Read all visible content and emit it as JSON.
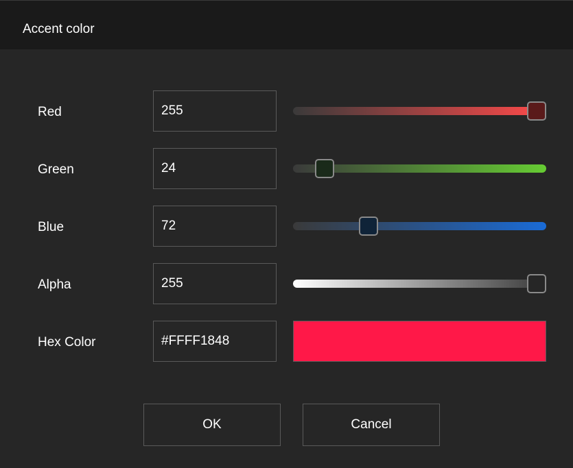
{
  "dialog": {
    "title": "Accent color"
  },
  "rows": {
    "red": {
      "label": "Red",
      "value": "255",
      "level": 1.0,
      "track_from": "#3a3a3a",
      "track_to": "#ff4a4a",
      "thumb_fill": "#5a1a1a"
    },
    "green": {
      "label": "Green",
      "value": "24",
      "level": 0.094,
      "track_from": "#3a3a3a",
      "track_to": "#66cc33",
      "thumb_fill": "#1a2a1a"
    },
    "blue": {
      "label": "Blue",
      "value": "72",
      "level": 0.282,
      "track_from": "#3a3a3a",
      "track_to": "#1a6bd6",
      "thumb_fill": "#0f2338"
    },
    "alpha": {
      "label": "Alpha",
      "value": "255",
      "level": 1.0,
      "track_from": "#ffffff",
      "track_to": "#3a3a3a",
      "thumb_fill": "#262626"
    }
  },
  "hex": {
    "label": "Hex Color",
    "value": "#FFFF1848",
    "preview_color": "#ff1848"
  },
  "buttons": {
    "ok_label": "OK",
    "cancel_label": "Cancel"
  }
}
